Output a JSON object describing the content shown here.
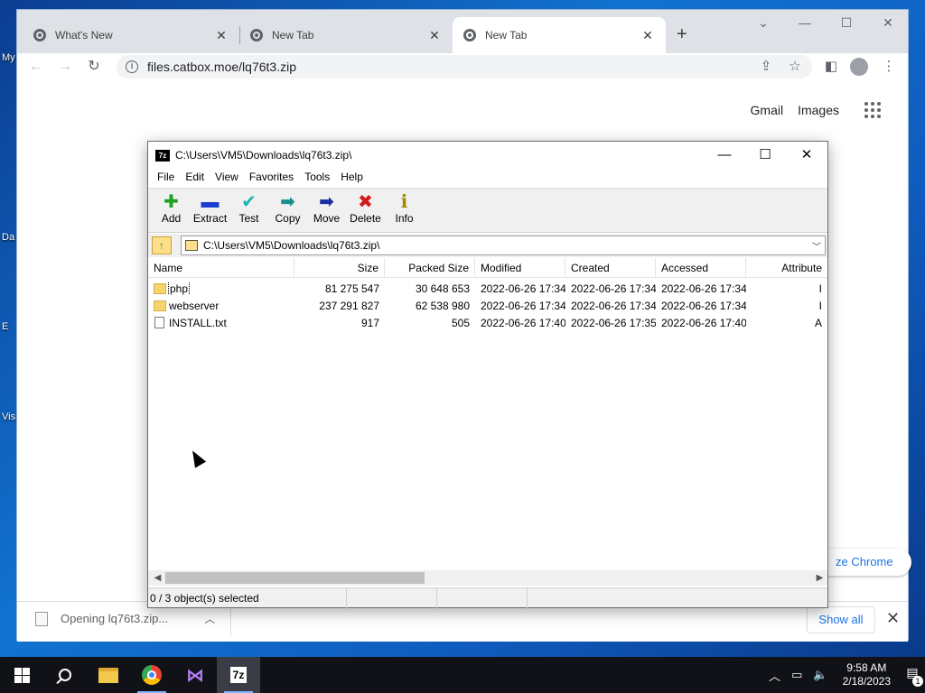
{
  "desktop": {
    "labels": [
      "My",
      "Da",
      "E",
      "Vis"
    ]
  },
  "browser": {
    "tabs": [
      {
        "title": "What's New",
        "active": false
      },
      {
        "title": "New Tab",
        "active": false
      },
      {
        "title": "New Tab",
        "active": true
      }
    ],
    "url": "files.catbox.moe/lq76t3.zip",
    "newtab_links": {
      "gmail": "Gmail",
      "images": "Images"
    },
    "customize_label": "ze Chrome",
    "download": {
      "label": "Opening lq76t3.zip...",
      "show_all": "Show all"
    }
  },
  "sevenzip": {
    "title": "C:\\Users\\VM5\\Downloads\\lq76t3.zip\\",
    "menu": [
      "File",
      "Edit",
      "View",
      "Favorites",
      "Tools",
      "Help"
    ],
    "toolbar": [
      {
        "label": "Add",
        "icon": "add-icon",
        "glyph": "✚",
        "color": "#1fa21f"
      },
      {
        "label": "Extract",
        "icon": "extract-icon",
        "glyph": "▬",
        "color": "#1b3fcf"
      },
      {
        "label": "Test",
        "icon": "test-icon",
        "glyph": "✔",
        "color": "#19b5b5"
      },
      {
        "label": "Copy",
        "icon": "copy-icon",
        "glyph": "➡",
        "color": "#1c8e8e"
      },
      {
        "label": "Move",
        "icon": "move-icon",
        "glyph": "➡",
        "color": "#1a2f9e"
      },
      {
        "label": "Delete",
        "icon": "delete-icon",
        "glyph": "✖",
        "color": "#d11b1b"
      },
      {
        "label": "Info",
        "icon": "info-icon",
        "glyph": "ℹ",
        "color": "#a08a00"
      }
    ],
    "address": "C:\\Users\\VM5\\Downloads\\lq76t3.zip\\",
    "columns": {
      "name": "Name",
      "size": "Size",
      "packed": "Packed Size",
      "modified": "Modified",
      "created": "Created",
      "accessed": "Accessed",
      "attributes": "Attribute"
    },
    "rows": [
      {
        "name": "php",
        "type": "folder",
        "size": "81 275 547",
        "packed": "30 648 653",
        "modified": "2022-06-26 17:34",
        "created": "2022-06-26 17:34",
        "accessed": "2022-06-26 17:34",
        "attr": "I"
      },
      {
        "name": "webserver",
        "type": "folder",
        "size": "237 291 827",
        "packed": "62 538 980",
        "modified": "2022-06-26 17:34",
        "created": "2022-06-26 17:34",
        "accessed": "2022-06-26 17:34",
        "attr": "I"
      },
      {
        "name": "INSTALL.txt",
        "type": "file",
        "size": "917",
        "packed": "505",
        "modified": "2022-06-26 17:40",
        "created": "2022-06-26 17:35",
        "accessed": "2022-06-26 17:40",
        "attr": "A"
      }
    ],
    "status": "0 / 3 object(s) selected"
  },
  "taskbar": {
    "time": "9:58 AM",
    "date": "2/18/2023",
    "notifications": "1"
  }
}
